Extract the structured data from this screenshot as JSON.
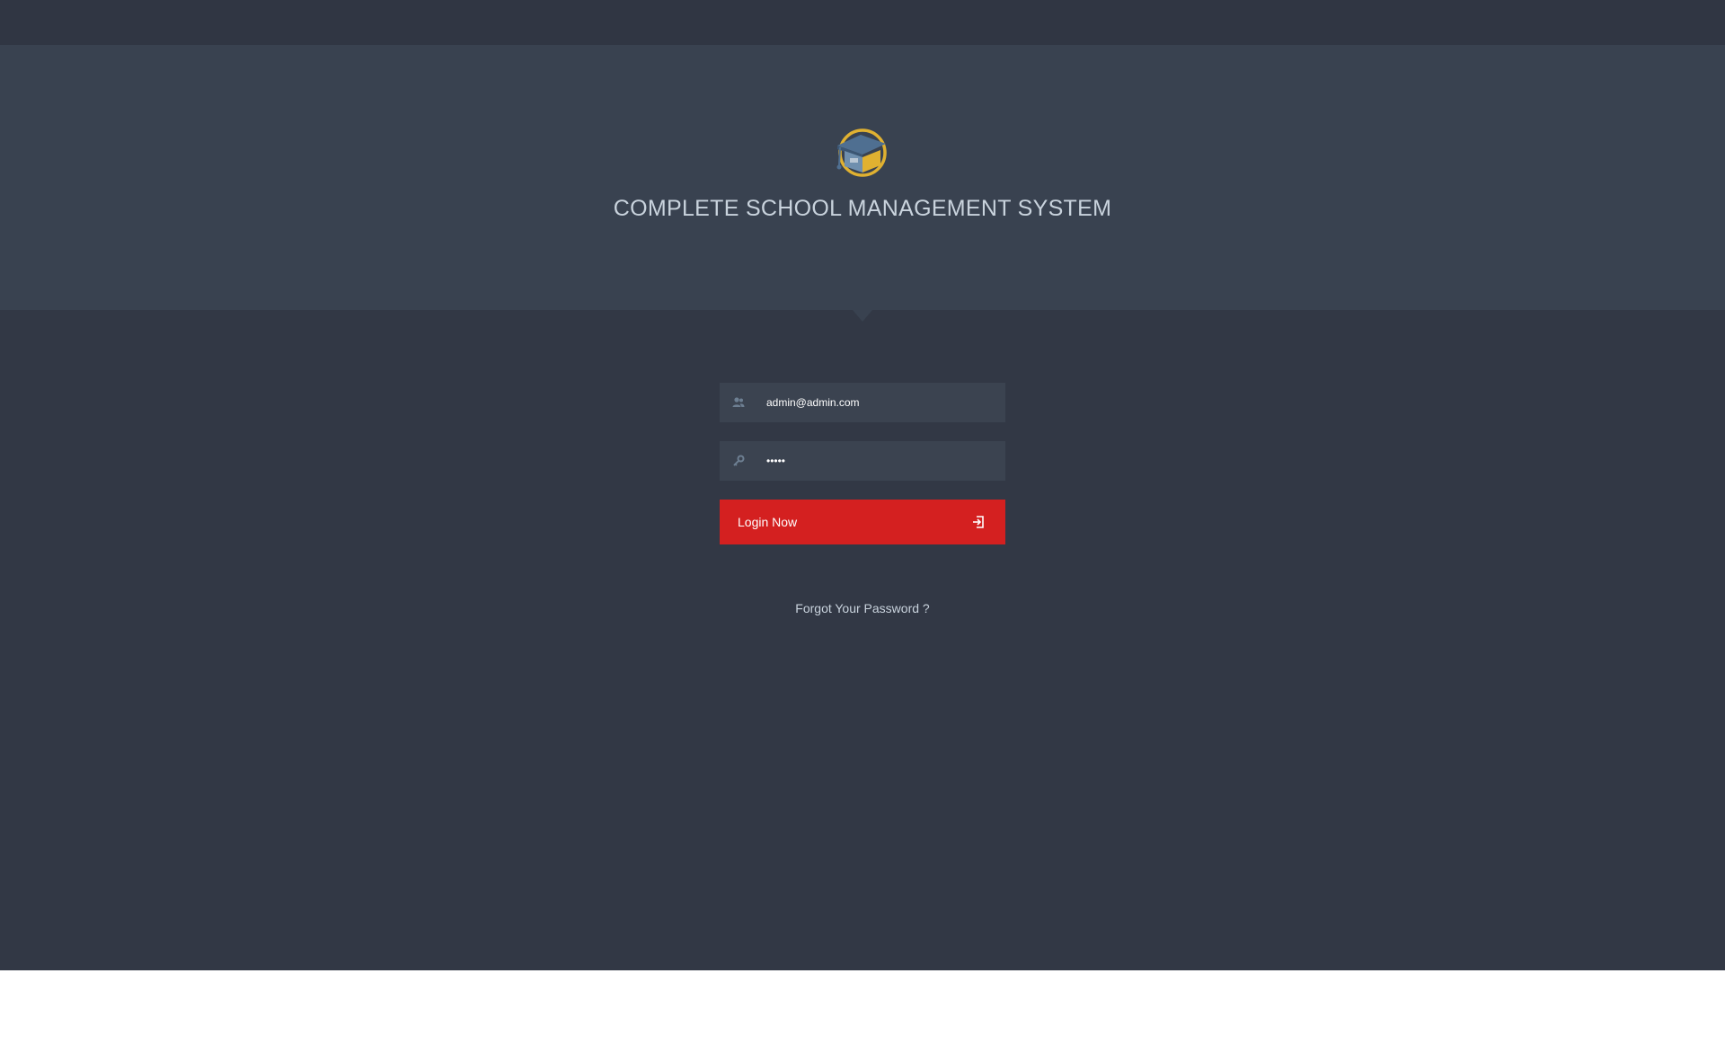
{
  "header": {
    "logo_icon": "graduation-cap-logo-icon",
    "title": "COMPLETE SCHOOL MANAGEMENT SYSTEM"
  },
  "login": {
    "email": {
      "icon": "user-icon",
      "value": "admin@admin.com"
    },
    "password": {
      "icon": "key-icon",
      "value": "•••••"
    },
    "submit": {
      "label": "Login Now",
      "icon": "sign-in-icon"
    },
    "forgot_label": "Forgot Your Password ?"
  },
  "colors": {
    "background": "#323845",
    "header_band": "#394250",
    "input_background": "#3b4350",
    "button": "#d42020",
    "title_text": "#c9d3dd",
    "logo_gold": "#e0b131"
  }
}
